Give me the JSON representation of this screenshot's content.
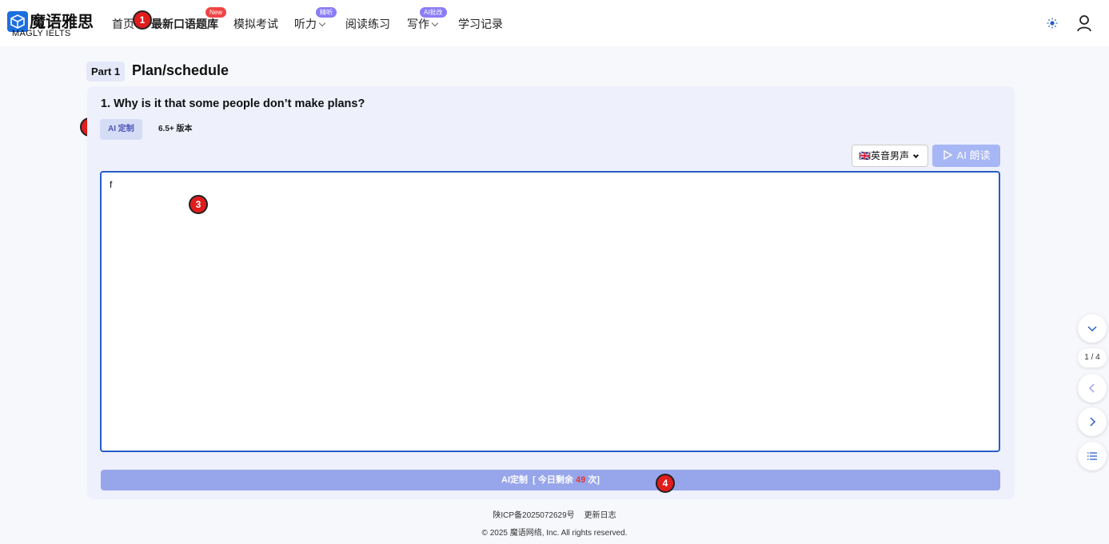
{
  "logo": {
    "cn": "魔语雅思",
    "en": "MAGLY IELTS"
  },
  "nav": {
    "home": "首页",
    "latest": "最新口语题库",
    "latest_badge": "New",
    "mock": "模拟考试",
    "listening": "听力",
    "listening_badge": "精听",
    "reading": "阅读练习",
    "writing": "写作",
    "writing_badge": "AI批改",
    "records": "学习记录"
  },
  "markers": [
    "1",
    "2",
    "3",
    "4"
  ],
  "part": {
    "tag": "Part 1",
    "title": "Plan/schedule"
  },
  "question": "1. Why is it that some people don’t make plans?",
  "tabs": {
    "ai": "AI 定制",
    "version": "6.5+ 版本"
  },
  "voice": {
    "flag": "🇬🇧",
    "selected": "英音男声"
  },
  "read_button": "AI 朗读",
  "answer_value": "f",
  "generate": {
    "label": "AI定制",
    "remain_prefix": "[ 今日剩余 ",
    "remain_count": "49",
    "remain_suffix": " 次]"
  },
  "footer": {
    "icp": "陕ICP备2025072629号",
    "changelog": "更新日志",
    "copyright": "© 2025 魔语网络, Inc. All rights reserved."
  },
  "pager": {
    "indicator": "1 / 4"
  },
  "colors": {
    "accent": "#2a5cc8",
    "button": "#97a5ea",
    "badge_new": "#ef4444",
    "badge_purple": "#8b7cf6"
  }
}
